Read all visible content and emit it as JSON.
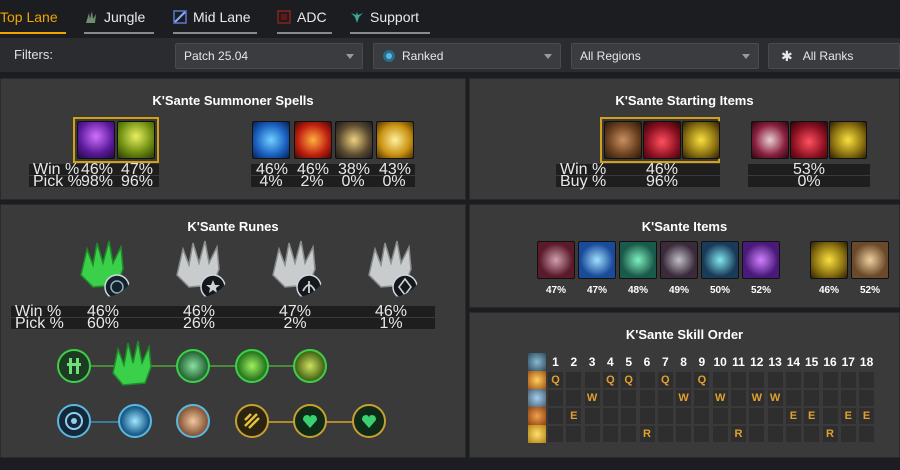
{
  "nav": {
    "tabs": [
      {
        "label": "Top Lane",
        "icon": "top-lane-icon"
      },
      {
        "label": "Jungle",
        "icon": "jungle-icon"
      },
      {
        "label": "Mid Lane",
        "icon": "mid-lane-icon"
      },
      {
        "label": "ADC",
        "icon": "adc-icon"
      },
      {
        "label": "Support",
        "icon": "support-icon"
      }
    ],
    "active": "Top Lane"
  },
  "filters": {
    "label": "Filters:",
    "patch": "Patch 25.04",
    "queue": "Ranked",
    "region": "All Regions",
    "rank": "All Ranks"
  },
  "spells": {
    "title": "K'Sante Summoner Spells",
    "row_labels": {
      "win": "Win %",
      "pick": "Pick %"
    },
    "sets": [
      {
        "icons": [
          "flash-icon",
          "ghost-icon"
        ],
        "win": [
          "46%",
          "47%"
        ],
        "pick": [
          "98%",
          "96%"
        ]
      },
      {
        "icons": [
          "ghost-icon",
          "ignite-icon",
          "teleport-icon",
          "heal-icon"
        ],
        "win": [
          "46%",
          "46%",
          "38%",
          "43%"
        ],
        "pick": [
          "4%",
          "2%",
          "0%",
          "0%"
        ]
      }
    ]
  },
  "starting": {
    "title": "K'Sante Starting Items",
    "row_labels": {
      "win": "Win %",
      "buy": "Buy %"
    },
    "sets": [
      {
        "icons": [
          "dorans-shield-icon",
          "health-potion-icon",
          "stealth-ward-icon"
        ],
        "win": "46%",
        "buy": "96%"
      },
      {
        "icons": [
          "dorans-blade-icon",
          "health-potion-icon",
          "stealth-ward-icon"
        ],
        "win": "53%",
        "buy": "0%"
      }
    ]
  },
  "runes": {
    "title": "K'Sante Runes",
    "row_labels": {
      "win": "Win %",
      "pick": "Pick %"
    },
    "keystones": [
      {
        "win": "46%",
        "pick": "60%"
      },
      {
        "win": "46%",
        "pick": "26%"
      },
      {
        "win": "47%",
        "pick": "2%"
      },
      {
        "win": "46%",
        "pick": "1%"
      }
    ]
  },
  "items": {
    "title": "K'Sante Items",
    "core": [
      "47%",
      "47%",
      "48%",
      "49%",
      "50%",
      "52%"
    ],
    "boots": [
      "46%",
      "52%"
    ]
  },
  "skills": {
    "title": "K'Sante Skill Order",
    "levels": [
      "1",
      "2",
      "3",
      "4",
      "5",
      "6",
      "7",
      "8",
      "9",
      "10",
      "11",
      "12",
      "13",
      "14",
      "15",
      "16",
      "17",
      "18"
    ],
    "rows": [
      {
        "key": "Q",
        "levels": [
          1,
          4,
          5,
          7,
          9
        ]
      },
      {
        "key": "W",
        "levels": [
          3,
          8,
          10,
          12,
          13
        ]
      },
      {
        "key": "E",
        "levels": [
          2,
          14,
          15,
          17,
          18
        ]
      },
      {
        "key": "R",
        "levels": [
          6,
          11,
          16
        ]
      }
    ]
  },
  "colors": {
    "accent": "#f0a500",
    "panel": "#3a3a3a",
    "skill_letter": "#e0a030"
  }
}
